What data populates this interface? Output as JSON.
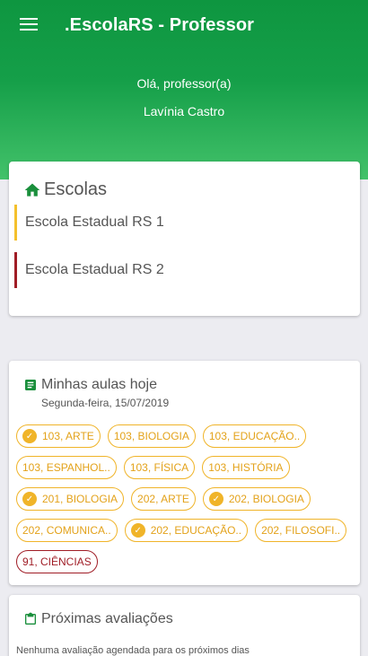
{
  "header": {
    "title": ".EscolaRS - Professor",
    "greeting": "Olá, professor(a)",
    "teacher_name": "Lavínia Castro"
  },
  "schools": {
    "title": "Escolas",
    "items": [
      {
        "name": "Escola Estadual RS 1",
        "color": "#f4c02c"
      },
      {
        "name": "Escola Estadual RS 2",
        "color": "#a01d26"
      }
    ]
  },
  "classes": {
    "title": "Minhas aulas hoje",
    "date": "Segunda-feira, 15/07/2019",
    "chips": [
      {
        "label": "103, ARTE",
        "checked": true
      },
      {
        "label": "103, BIOLOGIA",
        "checked": false
      },
      {
        "label": "103, EDUCAÇÃO..",
        "checked": false
      },
      {
        "label": "103, ESPANHOL..",
        "checked": false
      },
      {
        "label": "103, FÍSICA",
        "checked": false
      },
      {
        "label": "103, HISTÓRIA",
        "checked": false
      },
      {
        "label": "201, BIOLOGIA",
        "checked": true
      },
      {
        "label": "202, ARTE",
        "checked": false
      },
      {
        "label": "202, BIOLOGIA",
        "checked": true
      },
      {
        "label": "202, COMUNICA..",
        "checked": false
      },
      {
        "label": "202, EDUCAÇÃO..",
        "checked": true
      },
      {
        "label": "202, FILOSOFI..",
        "checked": false
      },
      {
        "label": "91, CIÊNCIAS",
        "checked": false
      }
    ]
  },
  "evaluations": {
    "title": "Próximas avaliações",
    "empty_text": "Nenhuma avaliação agendada para os próximos dias"
  },
  "colors": {
    "primary": "#0e9640",
    "accent": "#f0b429",
    "alert": "#a01d26"
  },
  "icons": {
    "menu": "menu-icon",
    "schools": "home-icon",
    "classes": "document-icon",
    "evaluations": "clipboard-icon",
    "chip_check": "check-circle-icon"
  }
}
